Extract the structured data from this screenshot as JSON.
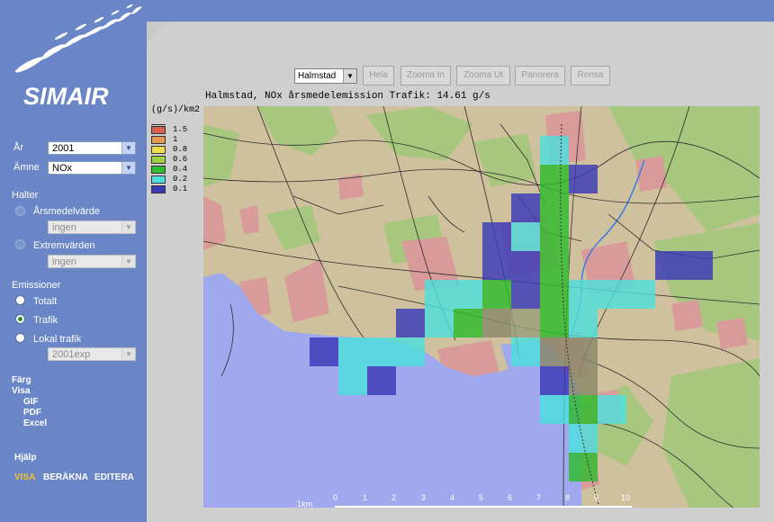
{
  "app": {
    "logo_text": "SIMAIR"
  },
  "sidebar": {
    "year_label": "År",
    "year_value": "2001",
    "substance_label": "Ämne",
    "substance_value": "NOx",
    "halter_label": "Halter",
    "halter_options": [
      {
        "label": "Årsmedelvärde",
        "select_value": "ingen",
        "selected": false
      },
      {
        "label": "Extremvärden",
        "select_value": "ingen",
        "selected": false
      }
    ],
    "emissioner_label": "Emissioner",
    "emission_options": [
      {
        "label": "Totalt",
        "selected": false
      },
      {
        "label": "Trafik",
        "selected": true
      },
      {
        "label": "Lokal trafik",
        "selected": false
      }
    ],
    "lokal_select_value": "2001exp",
    "farg_label": "Färg",
    "visa_label": "Visa",
    "visa_items": [
      "GIF",
      "PDF",
      "Excel"
    ],
    "hjalp_label": "Hjälp",
    "modes": [
      {
        "label": "VISA",
        "active": true
      },
      {
        "label": "BERÄKNA",
        "active": false
      },
      {
        "label": "EDITERA",
        "active": false
      }
    ]
  },
  "toolbar": {
    "city_value": "Halmstad",
    "buttons": [
      "Hela",
      "Zooma In",
      "Zooma Ut",
      "Panorera",
      "Rensa"
    ]
  },
  "map": {
    "title": "Halmstad, NOx årsmedelemission Trafik: 14.61 g/s",
    "unit": "(g/s)/km2",
    "legend": [
      {
        "value": "1.5",
        "color": "#d95f4f"
      },
      {
        "value": "1",
        "color": "#e79a4e"
      },
      {
        "value": "0.8",
        "color": "#ede04a"
      },
      {
        "value": "0.6",
        "color": "#9bd33f"
      },
      {
        "value": "0.4",
        "color": "#2ebd2e"
      },
      {
        "value": "0.2",
        "color": "#4de0dc"
      },
      {
        "value": "0.1",
        "color": "#3a3ab8"
      }
    ],
    "scale_label": "1km",
    "scale_ticks": [
      "0",
      "1",
      "2",
      "3",
      "4",
      "5",
      "6",
      "7",
      "8",
      "9",
      "10"
    ]
  }
}
